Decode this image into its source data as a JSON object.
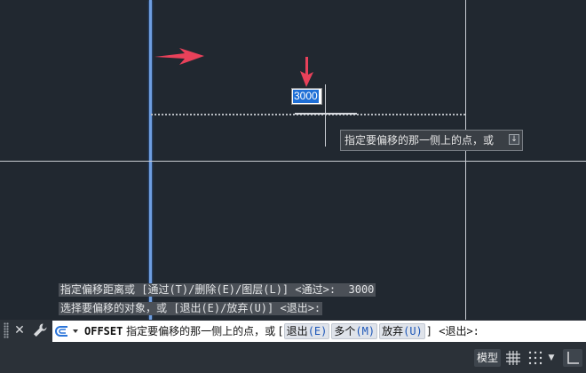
{
  "drawing": {
    "dynamic_input_value": "3000",
    "tooltip_text": "指定要偏移的那一侧上的点，或",
    "tooltip_icon": "down-arrow-icon",
    "colors": {
      "background": "#212830",
      "selected_line": "#6f9ee0",
      "arrow": "#e8415a"
    }
  },
  "command_history": [
    "指定偏移距离或 [通过(T)/删除(E)/图层(L)] <通过>:  3000",
    "选择要偏移的对象，或 [退出(E)/放弃(U)] <退出>:"
  ],
  "command_line": {
    "command": "OFFSET",
    "prompt": " 指定要偏移的那一侧上的点，或 [",
    "options": [
      {
        "label": "退出",
        "key": "(E)"
      },
      {
        "label": "多个",
        "key": "(M)"
      },
      {
        "label": "放弃",
        "key": "(U)"
      }
    ],
    "suffix": "] <退出>:"
  },
  "status_bar": {
    "model_label": "模型",
    "icons": [
      "grid-icon",
      "snap-icon",
      "chevron-down-icon",
      "ortho-icon"
    ]
  }
}
